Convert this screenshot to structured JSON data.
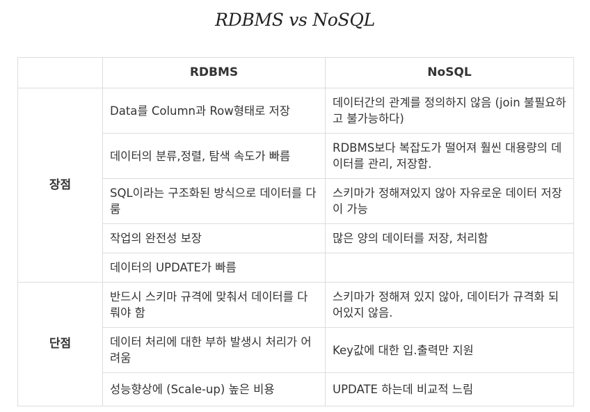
{
  "title": "RDBMS vs NoSQL",
  "table": {
    "headers": [
      "",
      "RDBMS",
      "NoSQL"
    ],
    "groups": [
      {
        "label": "장점",
        "rows": [
          {
            "rdbms": "Data를 Column과 Row형태로 저장",
            "nosql": "데이터간의 관계를 정의하지 않음 (join 불필요하고 불가능하다)"
          },
          {
            "rdbms": "데이터의 분류,정렬, 탐색 속도가 빠름",
            "nosql": "RDBMS보다 복잡도가 떨어져 훨씬 대용량의 데이터를 관리, 저장함."
          },
          {
            "rdbms": "SQL이라는 구조화된 방식으로 데이터를 다룸",
            "nosql": "스키마가 정해져있지 않아 자유로운 데이터 저장이 가능"
          },
          {
            "rdbms": "작업의 완전성 보장",
            "nosql": "많은 양의 데이터를 저장, 처리함"
          },
          {
            "rdbms": "데이터의 UPDATE가 빠름",
            "nosql": ""
          }
        ]
      },
      {
        "label": "단점",
        "rows": [
          {
            "rdbms": "반드시 스키마 규격에 맞춰서 데이터를 다뤄야 함",
            "nosql": "스키마가 정해져 있지 않아, 데이터가 규격화 되어있지 않음."
          },
          {
            "rdbms": "데이터 처리에 대한 부하 발생시 처리가 어려움",
            "nosql": "Key값에 대한 입.출력만 지원"
          },
          {
            "rdbms": "성능향상에 (Scale-up) 높은 비용",
            "nosql": "UPDATE 하는데 비교적 느림"
          }
        ]
      }
    ]
  }
}
